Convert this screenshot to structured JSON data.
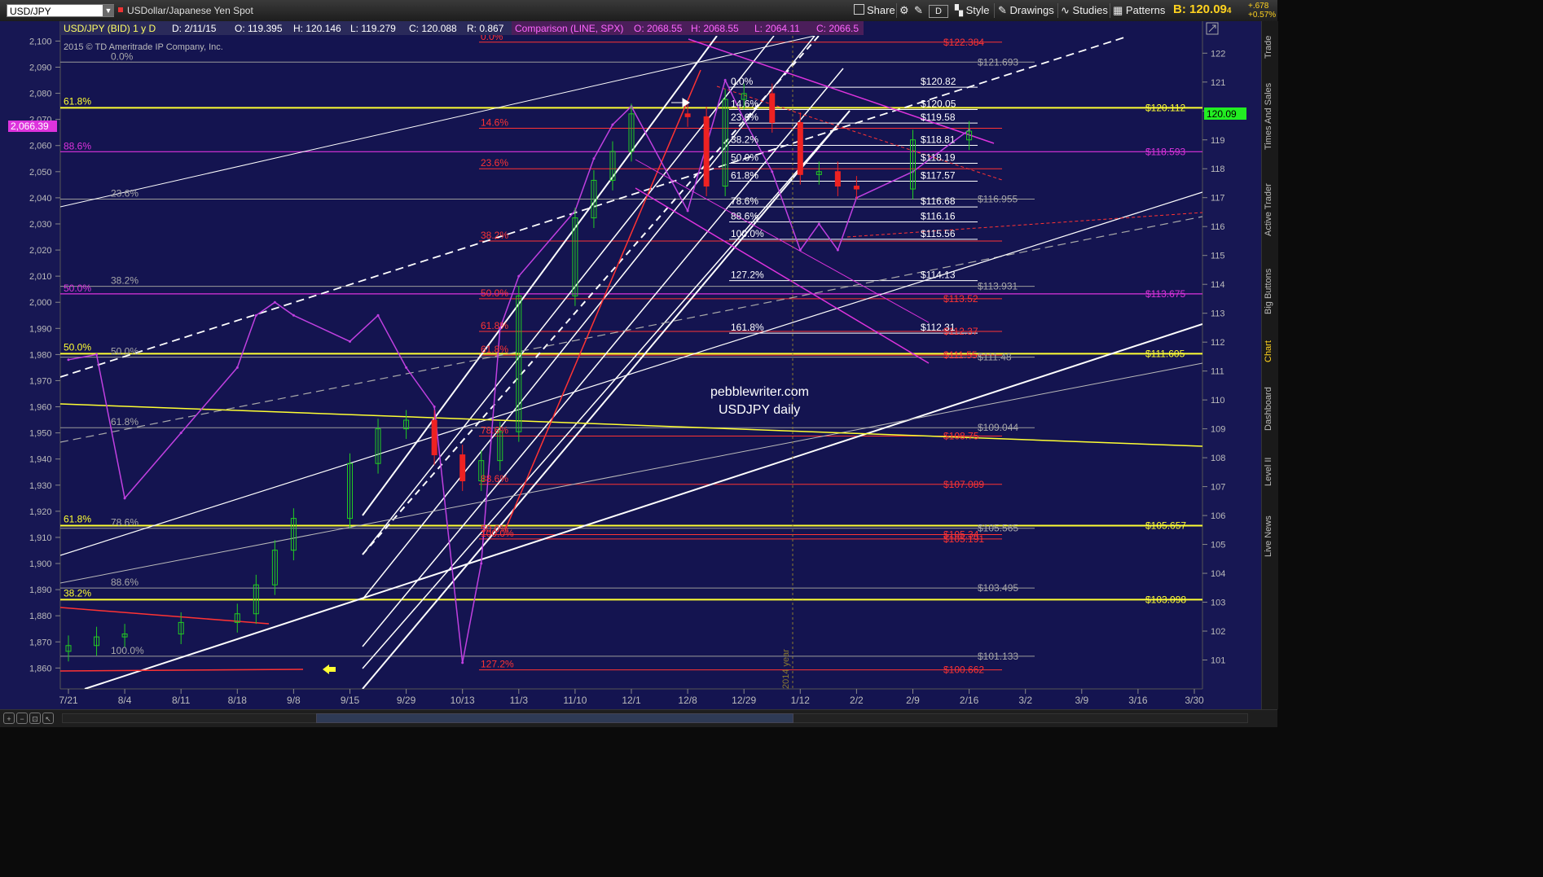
{
  "toolbar": {
    "symbol": "USD/JPY",
    "description": "USDollar/Japanese Yen Spot",
    "share": "Share",
    "style": "Style",
    "drawings": "Drawings",
    "studies": "Studies",
    "patterns": "Patterns",
    "d_button": "D",
    "bid_label": "B: 120.09",
    "bid_suffix": "4",
    "change_pts": "+.678",
    "change_pct": "+0.57%"
  },
  "info_bar": {
    "symbol": "USD/JPY (BID) 1 y D",
    "date": "D: 2/11/15",
    "open": "O: 119.395",
    "high": "H: 120.146",
    "low": "L: 119.279",
    "close": "C: 120.088",
    "range": "R: 0.867",
    "comparison": "Comparison (LINE, SPX)",
    "comp_open": "O: 2068.55",
    "comp_high": "H: 2068.55",
    "comp_low": "L: 2064.11",
    "comp_close": "C: 2066.5"
  },
  "copyright": "2015 © TD Ameritrade IP Company, Inc.",
  "watermark": {
    "line1": "pebblewriter.com",
    "line2": "USDJPY daily"
  },
  "year_marker": "2014 year",
  "side_tabs": [
    "Trade",
    "Times And Sales",
    "Active Trader",
    "Big Buttons",
    "Chart",
    "Dashboard",
    "Level II",
    "Live News"
  ],
  "colors": {
    "background": "#141450",
    "yellow": "#ffff33",
    "magenta": "#dd33dd",
    "red_fib": "#ff3333",
    "gray_fib": "#9a9a9a",
    "white": "#ffffff",
    "candle_up": "#22cc22",
    "candle_down": "#ee2222",
    "spx_line": "#c040e0"
  },
  "chart_data": {
    "type": "line",
    "title": "",
    "x_ticks": [
      "7/21",
      "8/4",
      "8/11",
      "8/18",
      "9/8",
      "9/15",
      "9/29",
      "10/13",
      "11/3",
      "11/10",
      "12/1",
      "12/8",
      "12/29",
      "1/12",
      "2/2",
      "2/9",
      "2/16",
      "3/2",
      "3/9",
      "3/16",
      "3/30"
    ],
    "left_axis": {
      "label": "SPX",
      "ylim": [
        1852,
        2102
      ],
      "ticks": [
        "1,860",
        "1,870",
        "1,880",
        "1,890",
        "1,900",
        "1,910",
        "1,920",
        "1,930",
        "1,940",
        "1,950",
        "1,960",
        "1,970",
        "1,980",
        "1,990",
        "2,000",
        "2,010",
        "2,020",
        "2,030",
        "2,040",
        "2,050",
        "2,060",
        "2,070",
        "2,080",
        "2,090",
        "2,100"
      ]
    },
    "right_axis": {
      "label": "USD/JPY",
      "ylim": [
        100.0,
        122.6
      ],
      "ticks": [
        "101",
        "102",
        "103",
        "104",
        "105",
        "106",
        "107",
        "108",
        "109",
        "110",
        "111",
        "112",
        "113",
        "114",
        "115",
        "116",
        "117",
        "118",
        "119",
        "120",
        "121",
        "122"
      ]
    },
    "current_price": "120.09",
    "spx_current": "2,066.39",
    "series": [
      {
        "name": "USD/JPY",
        "x": [
          "7/21",
          "7/28",
          "8/4",
          "8/11",
          "8/18",
          "8/25",
          "9/1",
          "9/8",
          "9/15",
          "9/22",
          "9/29",
          "10/6",
          "10/13",
          "10/20",
          "10/27",
          "11/3",
          "11/10",
          "11/17",
          "11/24",
          "12/1",
          "12/8",
          "12/15",
          "12/22",
          "12/29",
          "1/5",
          "1/12",
          "1/19",
          "1/26",
          "2/2",
          "2/9",
          "2/16"
        ],
        "values": [
          101.5,
          101.8,
          101.9,
          102.3,
          102.6,
          103.6,
          104.8,
          105.9,
          107.8,
          109.0,
          109.3,
          108.1,
          107.2,
          107.9,
          108.9,
          113.6,
          116.3,
          117.6,
          118.6,
          119.9,
          119.8,
          117.4,
          120.4,
          120.6,
          119.6,
          117.8,
          117.9,
          117.4,
          117.3,
          119.0,
          119.3
        ]
      },
      {
        "name": "SPX",
        "x": [
          "7/21",
          "7/28",
          "8/4",
          "8/11",
          "8/18",
          "8/25",
          "9/1",
          "9/8",
          "9/15",
          "9/22",
          "9/29",
          "10/6",
          "10/13",
          "10/20",
          "10/27",
          "11/3",
          "11/10",
          "11/17",
          "11/24",
          "12/1",
          "12/8",
          "12/15",
          "12/22",
          "12/29",
          "1/5",
          "1/12",
          "1/19",
          "1/26",
          "2/2",
          "2/9",
          "2/16"
        ],
        "values": [
          1978,
          1980,
          1925,
          1950,
          1975,
          1995,
          2000,
          1995,
          1985,
          1995,
          1975,
          1960,
          1862,
          1900,
          1990,
          2010,
          2035,
          2055,
          2068,
          2075,
          2035,
          2060,
          2085,
          2070,
          2050,
          2020,
          2030,
          2020,
          2040,
          2050,
          2066
        ]
      }
    ],
    "fib_levels": {
      "yellow": [
        {
          "label": "61.8%",
          "value": 120.11,
          "price": "$120.11",
          "suffix": "2"
        },
        {
          "label": "50.0%",
          "value": 111.6,
          "price": "$111.60",
          "suffix": "5"
        },
        {
          "label": "61.8%",
          "value": 105.65,
          "price": "$105.65",
          "suffix": "7"
        },
        {
          "label": "38.2%",
          "value": 103.09,
          "price": "$103.09",
          "suffix": "8"
        }
      ],
      "magenta": [
        {
          "label": "88.6%",
          "value": 118.59,
          "price": "$118.59",
          "suffix": "3"
        },
        {
          "label": "50.0%",
          "value": 113.67,
          "price": "$113.67",
          "suffix": "5"
        }
      ],
      "red": [
        {
          "label": "0.0%",
          "value": 122.38,
          "price": "$122.38",
          "suffix": "4"
        },
        {
          "label": "14.6%",
          "value": 119.4,
          "price": "",
          "suffix": ""
        },
        {
          "label": "23.6%",
          "value": 118.0,
          "price": "",
          "suffix": ""
        },
        {
          "label": "38.2%",
          "value": 115.5,
          "price": "",
          "suffix": ""
        },
        {
          "label": "50.0%",
          "value": 113.5,
          "price": "$113.5",
          "suffix": "2"
        },
        {
          "label": "61.8%",
          "value": 112.37,
          "price": "$112.37",
          "suffix": ""
        },
        {
          "label": "61.8%",
          "value": 111.55,
          "price": "$111.55",
          "suffix": ""
        },
        {
          "label": "78.6%",
          "value": 108.75,
          "price": "$108.75",
          "suffix": ""
        },
        {
          "label": "88.6%",
          "value": 107.08,
          "price": "$107.08",
          "suffix": "9"
        },
        {
          "label": "50.0%",
          "value": 105.34,
          "price": "$105.34",
          "suffix": ""
        },
        {
          "label": "100.0%",
          "value": 105.19,
          "price": "$105.19",
          "suffix": "1"
        },
        {
          "label": "127.2%",
          "value": 100.66,
          "price": "$100.66",
          "suffix": "2"
        }
      ],
      "gray": [
        {
          "label": "0.0%",
          "value": 121.69,
          "price": "$121.69",
          "suffix": "3"
        },
        {
          "label": "23.6%",
          "value": 116.95,
          "price": "$116.95",
          "suffix": "5"
        },
        {
          "label": "38.2%",
          "value": 113.93,
          "price": "$113.93",
          "suffix": "1"
        },
        {
          "label": "50.0%",
          "value": 111.48,
          "price": "$111.48",
          "suffix": ""
        },
        {
          "label": "61.8%",
          "value": 109.04,
          "price": "$109.04",
          "suffix": "4"
        },
        {
          "label": "78.6%",
          "value": 105.56,
          "price": "$105.56",
          "suffix": "5"
        },
        {
          "label": "88.6%",
          "value": 103.49,
          "price": "$103.49",
          "suffix": "5"
        },
        {
          "label": "100.0%",
          "value": 101.13,
          "price": "$101.13",
          "suffix": "3"
        }
      ],
      "white": [
        {
          "label": "0.0%",
          "value": 120.82,
          "price": "$120.82"
        },
        {
          "label": "14.6%",
          "value": 120.05,
          "price": "$120.05"
        },
        {
          "label": "23.6%",
          "value": 119.58,
          "price": "$119.58"
        },
        {
          "label": "38.2%",
          "value": 118.81,
          "price": "$118.81"
        },
        {
          "label": "50.0%",
          "value": 118.19,
          "price": "$118.19"
        },
        {
          "label": "61.8%",
          "value": 117.57,
          "price": "$117.57"
        },
        {
          "label": "78.6%",
          "value": 116.68,
          "price": "$116.68"
        },
        {
          "label": "88.6%",
          "value": 116.16,
          "price": "$116.16"
        },
        {
          "label": "100.0%",
          "value": 115.56,
          "price": "$115.56"
        },
        {
          "label": "127.2%",
          "value": 114.13,
          "price": "$114.13"
        },
        {
          "label": "161.8%",
          "value": 112.31,
          "price": "$112.31"
        }
      ]
    }
  }
}
